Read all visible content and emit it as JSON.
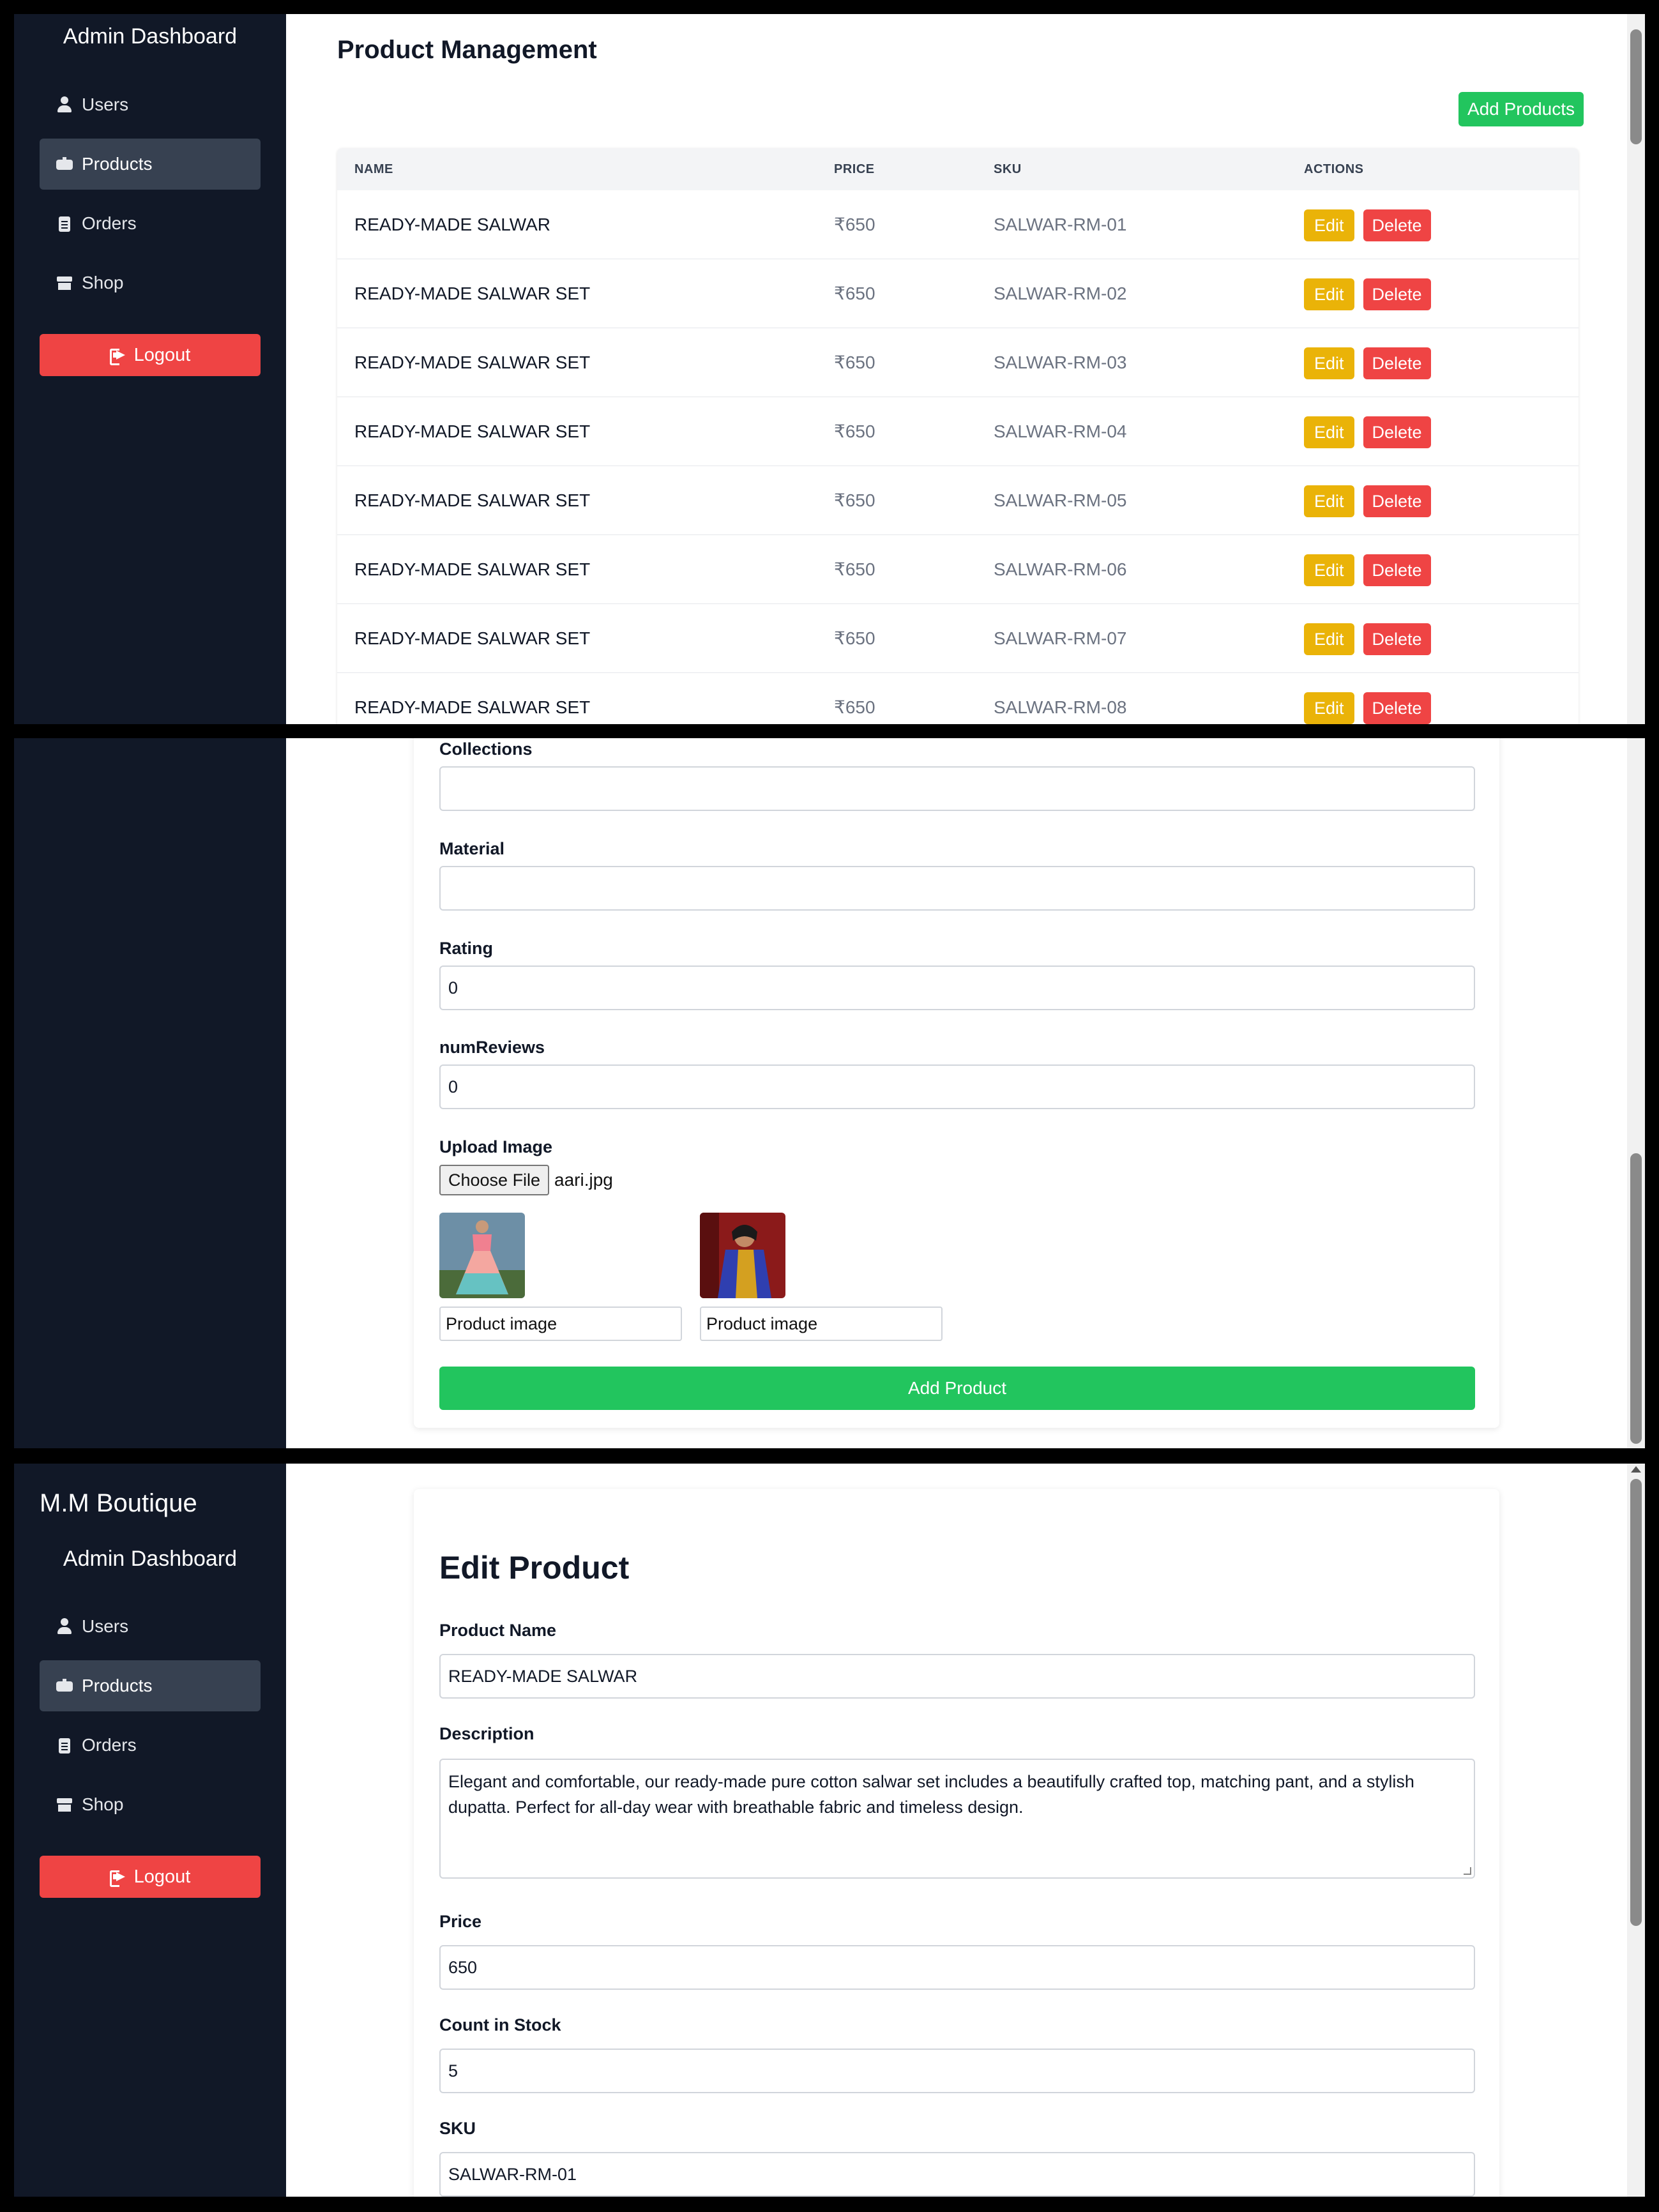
{
  "sidebar": {
    "brand": "M.M Boutique",
    "title": "Admin Dashboard",
    "items": [
      {
        "label": "Users",
        "icon": "user-icon"
      },
      {
        "label": "Products",
        "icon": "box-icon"
      },
      {
        "label": "Orders",
        "icon": "clipboard-icon"
      },
      {
        "label": "Shop",
        "icon": "store-icon"
      }
    ],
    "active": "Products",
    "logout": "Logout"
  },
  "products": {
    "title": "Product Management",
    "add_button": "Add Products",
    "columns": [
      "NAME",
      "PRICE",
      "SKU",
      "ACTIONS"
    ],
    "edit_label": "Edit",
    "delete_label": "Delete",
    "rows": [
      {
        "name": "READY-MADE SALWAR",
        "price": "₹650",
        "sku": "SALWAR-RM-01"
      },
      {
        "name": "READY-MADE SALWAR SET",
        "price": "₹650",
        "sku": "SALWAR-RM-02"
      },
      {
        "name": "READY-MADE SALWAR SET",
        "price": "₹650",
        "sku": "SALWAR-RM-03"
      },
      {
        "name": "READY-MADE SALWAR SET",
        "price": "₹650",
        "sku": "SALWAR-RM-04"
      },
      {
        "name": "READY-MADE SALWAR SET",
        "price": "₹650",
        "sku": "SALWAR-RM-05"
      },
      {
        "name": "READY-MADE SALWAR SET",
        "price": "₹650",
        "sku": "SALWAR-RM-06"
      },
      {
        "name": "READY-MADE SALWAR SET",
        "price": "₹650",
        "sku": "SALWAR-RM-07"
      },
      {
        "name": "READY-MADE SALWAR SET",
        "price": "₹650",
        "sku": "SALWAR-RM-08"
      }
    ]
  },
  "add_form": {
    "collections_label": "Collections",
    "collections_value": "",
    "material_label": "Material",
    "material_value": "",
    "rating_label": "Rating",
    "rating_value": "0",
    "numreviews_label": "numReviews",
    "numreviews_value": "0",
    "upload_label": "Upload Image",
    "choose_file": "Choose File",
    "file_name": "aari.jpg",
    "images": [
      {
        "alt_value": "Product image"
      },
      {
        "alt_value": "Product image"
      }
    ],
    "submit": "Add Product"
  },
  "edit_form": {
    "title": "Edit Product",
    "name_label": "Product Name",
    "name_value": "READY-MADE SALWAR",
    "description_label": "Description",
    "description_value": "Elegant and comfortable, our ready-made pure cotton salwar set includes a beautifully crafted top, matching pant, and a stylish dupatta. Perfect for all-day wear with breathable fabric and timeless design.",
    "price_label": "Price",
    "price_value": "650",
    "stock_label": "Count in Stock",
    "stock_value": "5",
    "sku_label": "SKU",
    "sku_value": "SALWAR-RM-01"
  },
  "colors": {
    "sidebar_bg": "#111827",
    "active_item": "#374151",
    "danger": "#ef4444",
    "success": "#22c55e",
    "warning": "#eab308"
  }
}
